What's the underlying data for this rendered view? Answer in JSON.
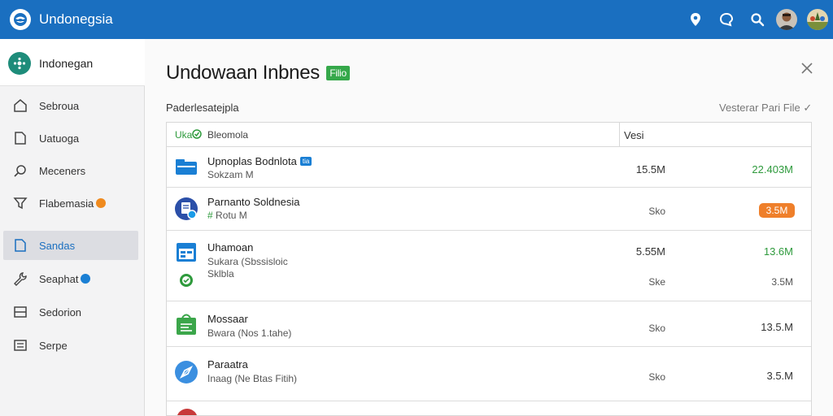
{
  "app": {
    "title": "Undonegsia"
  },
  "sidebar": {
    "title": "Indonegan",
    "items": [
      {
        "label": "Sebroua",
        "icon": "home-icon"
      },
      {
        "label": "Uatuoga",
        "icon": "document-icon"
      },
      {
        "label": "Meceners",
        "icon": "search-icon"
      },
      {
        "label": "Flabemasia",
        "icon": "funnel-icon",
        "badge_color": "#ef8a1e"
      },
      {
        "label": "Sandas",
        "icon": "file-icon",
        "active": true
      },
      {
        "label": "Seaphat",
        "icon": "wrench-icon",
        "badge_color": "#1a7fd4"
      },
      {
        "label": "Sedorion",
        "icon": "inbox-icon"
      },
      {
        "label": "Serpe",
        "icon": "list-icon"
      }
    ]
  },
  "dialog": {
    "title": "Undowaan Inbnes",
    "title_tag": "Filio",
    "subheader": "Paderlesatejpla",
    "filter_label": "Vesterar Pari File ✓"
  },
  "table": {
    "header_prefix": "Uka",
    "header_name": "Bleomola",
    "header_version": "Vesi",
    "rows": [
      {
        "name": "Upnoplas Bodnlota",
        "badge": "tia",
        "sub": "Sokzam M",
        "version": "15.5M",
        "size": "22.403M",
        "icon": "folder-icon"
      },
      {
        "name": "Parnanto Soldnesia",
        "sub": "Rotu M",
        "version": "Sko",
        "size": "3.5M",
        "size_style": "pill",
        "icon": "document-badge-icon"
      },
      {
        "name": "Uhamoan",
        "sub": "Sukara (Sbssisloic",
        "sub2": "Sklbla",
        "version": "5.55M",
        "size": "13.6M",
        "version2": "Ske",
        "size2": "3.5M",
        "icon": "calendar-icon"
      },
      {
        "name": "Mossaar",
        "sub": "Bwara (Nos 1.tahe)",
        "version": "Sko",
        "size": "13.5.M",
        "icon": "shopping-bag-icon"
      },
      {
        "name": "Paraatra",
        "sub": "Inaag (Ne Btas Fitih)",
        "version": "Sko",
        "size": "3.5.M",
        "icon": "compass-icon"
      }
    ]
  },
  "colors": {
    "accent": "#1a6fc0",
    "green": "#2e9a3c",
    "orange": "#ef7f2a"
  }
}
